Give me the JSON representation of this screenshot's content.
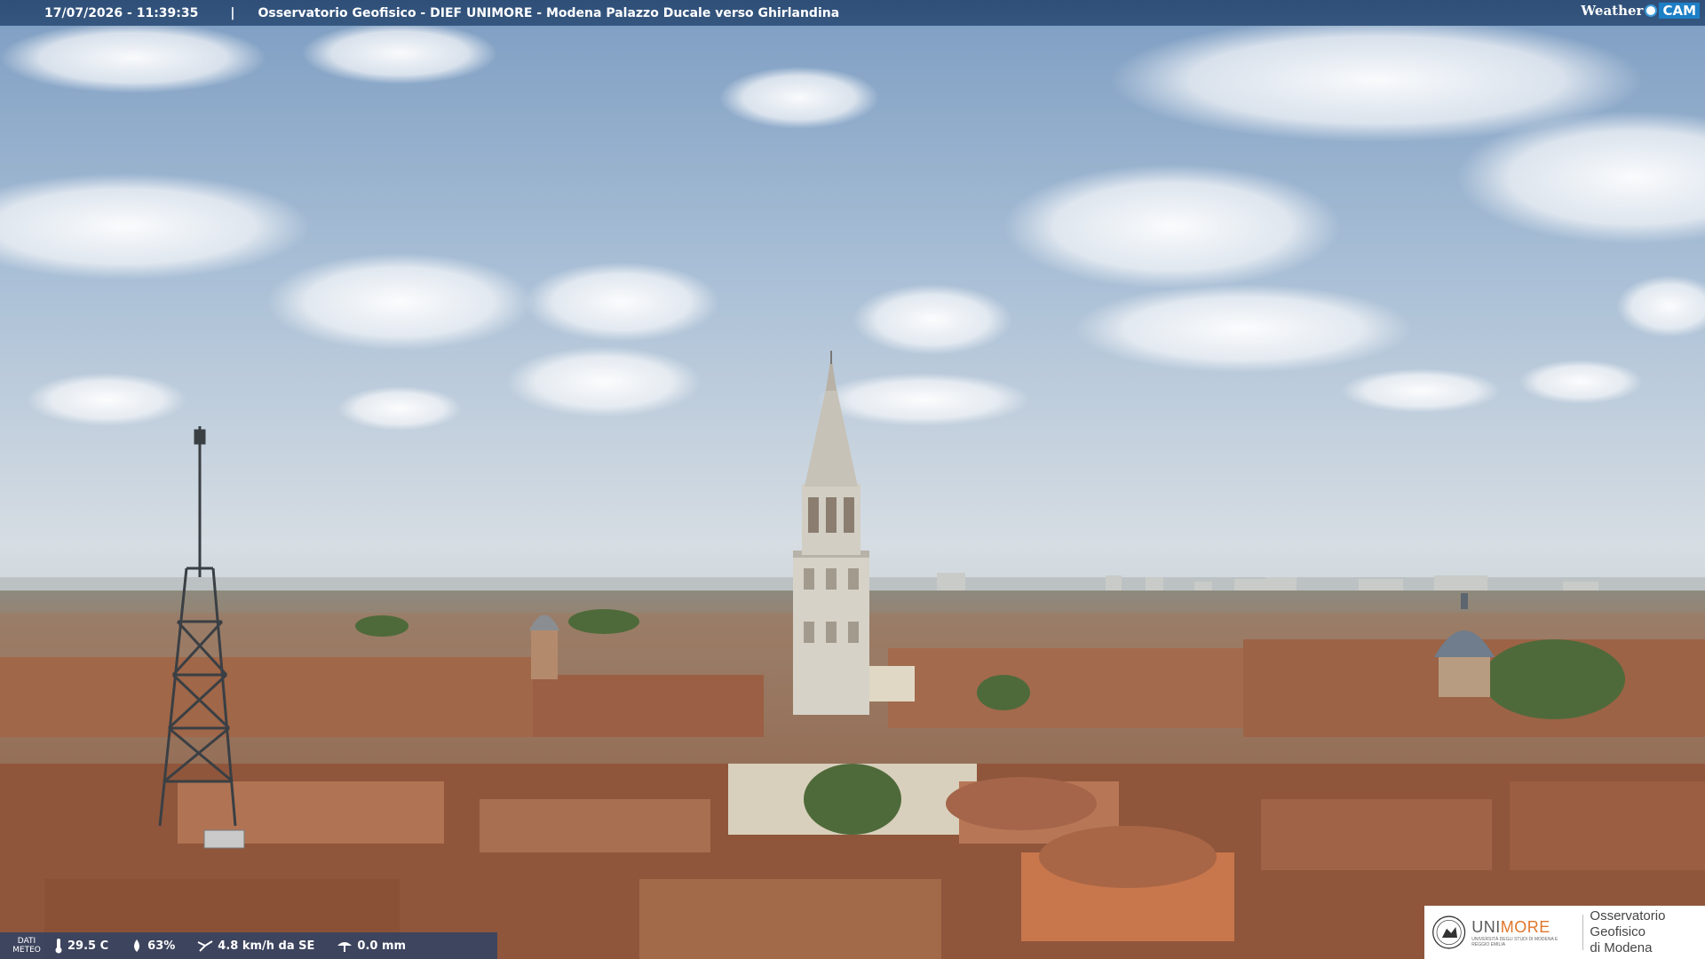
{
  "caption": {
    "datetime": "17/07/2026 - 11:39:35",
    "separator": "|",
    "location": "Osservatorio Geofisico - DIEF UNIMORE - Modena Palazzo Ducale verso Ghirlandina"
  },
  "brand": {
    "weather": "Weather",
    "cam": "CAM"
  },
  "meteo": {
    "label_line1": "DATI",
    "label_line2": "METEO",
    "temperature": "29.5 C",
    "humidity": "63%",
    "wind": "4.8 km/h da SE",
    "rain": "0.0 mm",
    "icons": [
      "thermometer-icon",
      "humidity-drop-icon",
      "wind-icon",
      "rain-gauge-icon"
    ]
  },
  "logo": {
    "name_part1": "UNI",
    "name_part2": "MORE",
    "subtitle": "UNIVERSITÀ DEGLI STUDI DI MODENA E REGGIO EMILIA",
    "observatory_line1": "Osservatorio Geofisico",
    "observatory_line2": "di Modena",
    "accent_color": "#e0762b"
  },
  "scene": {
    "description_colors": {
      "sky_top": "#7f9fc3",
      "sky_horizon": "#d7dde2",
      "roofs": "#a8684a"
    }
  }
}
